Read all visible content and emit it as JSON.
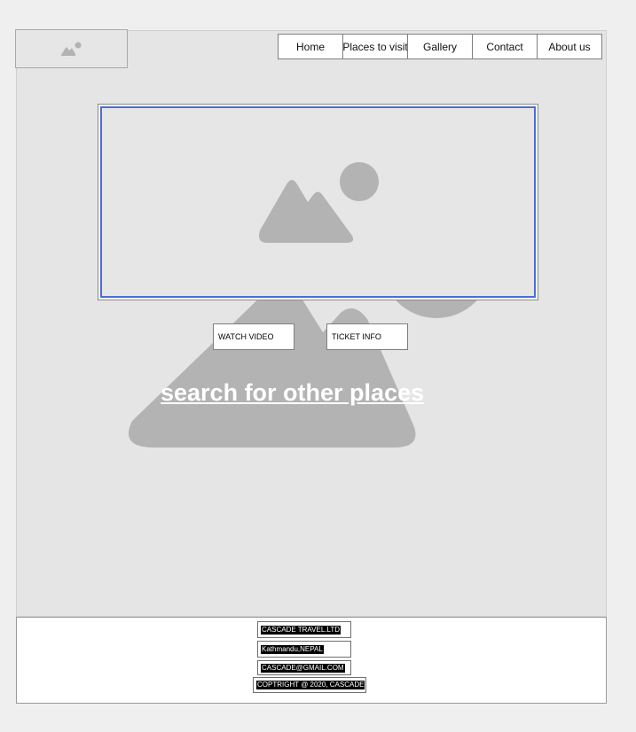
{
  "nav": {
    "items": [
      {
        "label": "Home"
      },
      {
        "label": "Places to visit"
      },
      {
        "label": "Gallery"
      },
      {
        "label": "Contact"
      },
      {
        "label": "About us"
      }
    ]
  },
  "icons": {
    "logo": "image-placeholder-icon",
    "hero": "image-placeholder-icon",
    "background": "image-placeholder-icon"
  },
  "buttons": {
    "watch_video": "WATCH VIDEO",
    "ticket_info": "TICKET INFO"
  },
  "search_link": "search for other places",
  "footer": {
    "company": "CASCADE TRAVEL.LTD",
    "location": "Kathmandu,NEPAL",
    "email": "CASCADE@GMAIL.COM",
    "copyright": "COPTRIGHT @ 2020, CASCADE"
  },
  "colors": {
    "hero_border": "#4a6fd3",
    "placeholder_gray": "#b3b3b3",
    "panel_bg": "#e5e5e5"
  }
}
